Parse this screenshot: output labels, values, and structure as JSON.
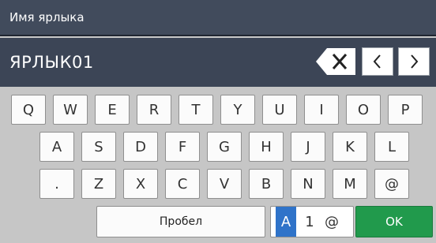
{
  "header": {
    "title": "Имя ярлыка"
  },
  "input": {
    "value": "ЯРЛЫК01"
  },
  "controls": {
    "backspace_icon": "backspace-icon",
    "left_icon": "chevron-left-icon",
    "right_icon": "chevron-right-icon"
  },
  "keyboard": {
    "row1": [
      "Q",
      "W",
      "E",
      "R",
      "T",
      "Y",
      "U",
      "I",
      "O",
      "P"
    ],
    "row2": [
      "A",
      "S",
      "D",
      "F",
      "G",
      "H",
      "J",
      "K",
      "L"
    ],
    "row3": [
      ".",
      "Z",
      "X",
      "C",
      "V",
      "B",
      "N",
      "M",
      "@"
    ],
    "space_label": "Пробел",
    "mode": {
      "active": "A",
      "numeric": "1",
      "symbol": "@"
    },
    "ok_label": "OK"
  },
  "colors": {
    "accent": "#2f73c9",
    "ok": "#219a4c",
    "header": "#414b5c"
  }
}
